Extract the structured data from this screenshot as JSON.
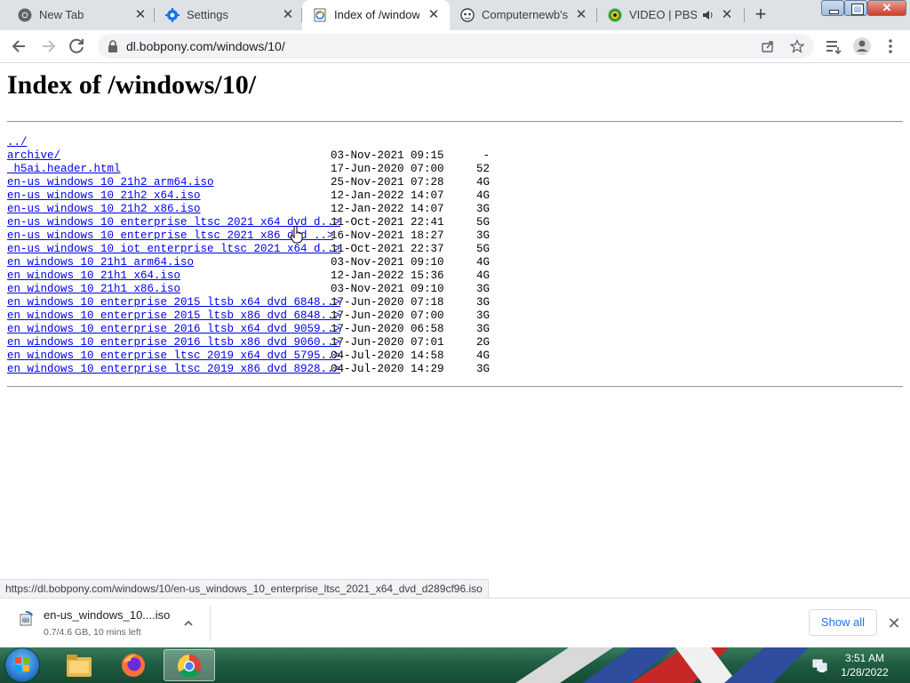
{
  "browser": {
    "tabs": [
      {
        "title": "New Tab",
        "icon": "chrome-icon"
      },
      {
        "title": "Settings",
        "icon": "gear-icon"
      },
      {
        "title": "Index of /windows",
        "icon": "ie-page-icon",
        "active": true
      },
      {
        "title": "Computernewb's In",
        "icon": "bot-icon"
      },
      {
        "title": "VIDEO | PBS KI",
        "icon": "pbs-icon",
        "audio": true
      }
    ],
    "address": "dl.bobpony.com/windows/10/"
  },
  "page": {
    "heading": "Index of /windows/10/",
    "entries": [
      {
        "name": "../",
        "date": "",
        "size": ""
      },
      {
        "name": "archive/",
        "date": "03-Nov-2021 09:15",
        "size": "-"
      },
      {
        "name": "_h5ai.header.html",
        "date": "17-Jun-2020 07:00",
        "size": "52"
      },
      {
        "name": "en-us_windows_10_21h2_arm64.iso",
        "date": "25-Nov-2021 07:28",
        "size": "4G"
      },
      {
        "name": "en-us_windows_10_21h2_x64.iso",
        "date": "12-Jan-2022 14:07",
        "size": "4G"
      },
      {
        "name": "en-us_windows_10_21h2_x86.iso",
        "date": "12-Jan-2022 14:07",
        "size": "3G"
      },
      {
        "name": "en-us_windows_10_enterprise_ltsc_2021_x64_dvd_d..>",
        "date": "11-Oct-2021 22:41",
        "size": "5G"
      },
      {
        "name": "en-us_windows_10_enterprise_ltsc_2021_x86_dvd_..>",
        "date": "16-Nov-2021 18:27",
        "size": "3G"
      },
      {
        "name": "en-us_windows_10_iot_enterprise_ltsc_2021_x64_d..>",
        "date": "11-Oct-2021 22:37",
        "size": "5G"
      },
      {
        "name": "en_windows_10_21h1_arm64.iso",
        "date": "03-Nov-2021 09:10",
        "size": "4G"
      },
      {
        "name": "en_windows_10_21h1_x64.iso",
        "date": "12-Jan-2022 15:36",
        "size": "4G"
      },
      {
        "name": "en_windows_10_21h1_x86.iso",
        "date": "03-Nov-2021 09:10",
        "size": "3G"
      },
      {
        "name": "en_windows_10_enterprise_2015_ltsb_x64_dvd_6848..>",
        "date": "17-Jun-2020 07:18",
        "size": "3G"
      },
      {
        "name": "en_windows_10_enterprise_2015_ltsb_x86_dvd_6848..>",
        "date": "17-Jun-2020 07:00",
        "size": "3G"
      },
      {
        "name": "en_windows_10_enterprise_2016_ltsb_x64_dvd_9059..>",
        "date": "17-Jun-2020 06:58",
        "size": "3G"
      },
      {
        "name": "en_windows_10_enterprise_2016_ltsb_x86_dvd_9060..>",
        "date": "17-Jun-2020 07:01",
        "size": "2G"
      },
      {
        "name": "en_windows_10_enterprise_ltsc_2019_x64_dvd_5795..>",
        "date": "04-Jul-2020 14:58",
        "size": "4G"
      },
      {
        "name": "en_windows_10_enterprise_ltsc_2019_x86_dvd_8928..>",
        "date": "04-Jul-2020 14:29",
        "size": "3G"
      }
    ]
  },
  "status_bar": {
    "url": "https://dl.bobpony.com/windows/10/en-us_windows_10_enterprise_ltsc_2021_x64_dvd_d289cf96.iso"
  },
  "downloads": {
    "file": "en-us_windows_10....iso",
    "progress": "0.7/4.6 GB, 10 mins left",
    "progress_fraction": 0.15,
    "show_all": "Show all"
  },
  "taskbar": {
    "apps": [
      "file-explorer-icon",
      "firefox-icon",
      "chrome-icon"
    ],
    "active_app": "chrome-icon",
    "time": "3:51 AM",
    "date": "1/28/2022"
  },
  "colors": {
    "link": "#0000ee",
    "tab_strip": "#dee1e6",
    "accent": "#1a73e8"
  }
}
